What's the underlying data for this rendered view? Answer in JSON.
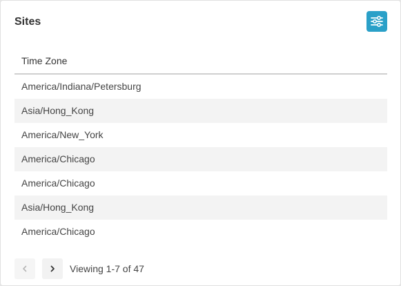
{
  "card": {
    "title": "Sites"
  },
  "filter_button": {
    "icon": "sliders-icon",
    "color": "#2aa0c8"
  },
  "table": {
    "column_header": "Time Zone",
    "rows": [
      "America/Indiana/Petersburg",
      "Asia/Hong_Kong",
      "America/New_York",
      "America/Chicago",
      "America/Chicago",
      "Asia/Hong_Kong",
      "America/Chicago"
    ]
  },
  "pagination": {
    "prev_icon": "chevron-left-icon",
    "next_icon": "chevron-right-icon",
    "status": "Viewing 1-7 of 47"
  }
}
